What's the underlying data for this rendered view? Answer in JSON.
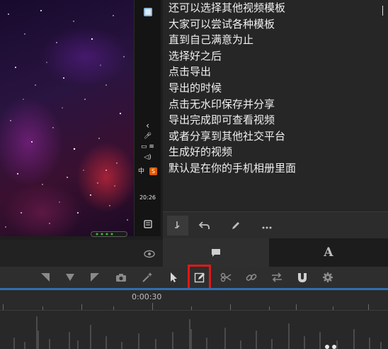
{
  "script_lines": [
    "还可以选择其他视频模板",
    "大家可以尝试各种模板",
    "直到自己满意为止",
    "选择好之后",
    "点击导出",
    "导出的时候",
    "点击无水印保存并分享",
    "导出完成即可查看视频",
    "或者分享到其他社交平台",
    "生成好的视频",
    "默认是在你的手机相册里面"
  ],
  "phone_sidebar": {
    "clock": "20:26",
    "app_badge": "S",
    "ime_label": "中",
    "volume_label": "◁)",
    "chevron": "‹"
  },
  "timeline": {
    "timecode": "0:00:30"
  },
  "accent_colors": {
    "highlight": "#e01818",
    "playhead_line": "#2e6fb0"
  },
  "icons": {
    "text_toolbar": [
      "insert-icon",
      "undo-icon",
      "pencil-icon",
      "more-icon"
    ],
    "tabs": [
      "comment-icon",
      "text-style-icon"
    ],
    "edit_toolbar": [
      "trim-left-icon",
      "marker-icon",
      "trim-right-icon",
      "camera-icon",
      "magic-wand-icon",
      "pointer-icon",
      "edit-icon",
      "scissors-icon",
      "link-icon",
      "swap-icon",
      "magnet-icon",
      "settings-icon"
    ]
  }
}
